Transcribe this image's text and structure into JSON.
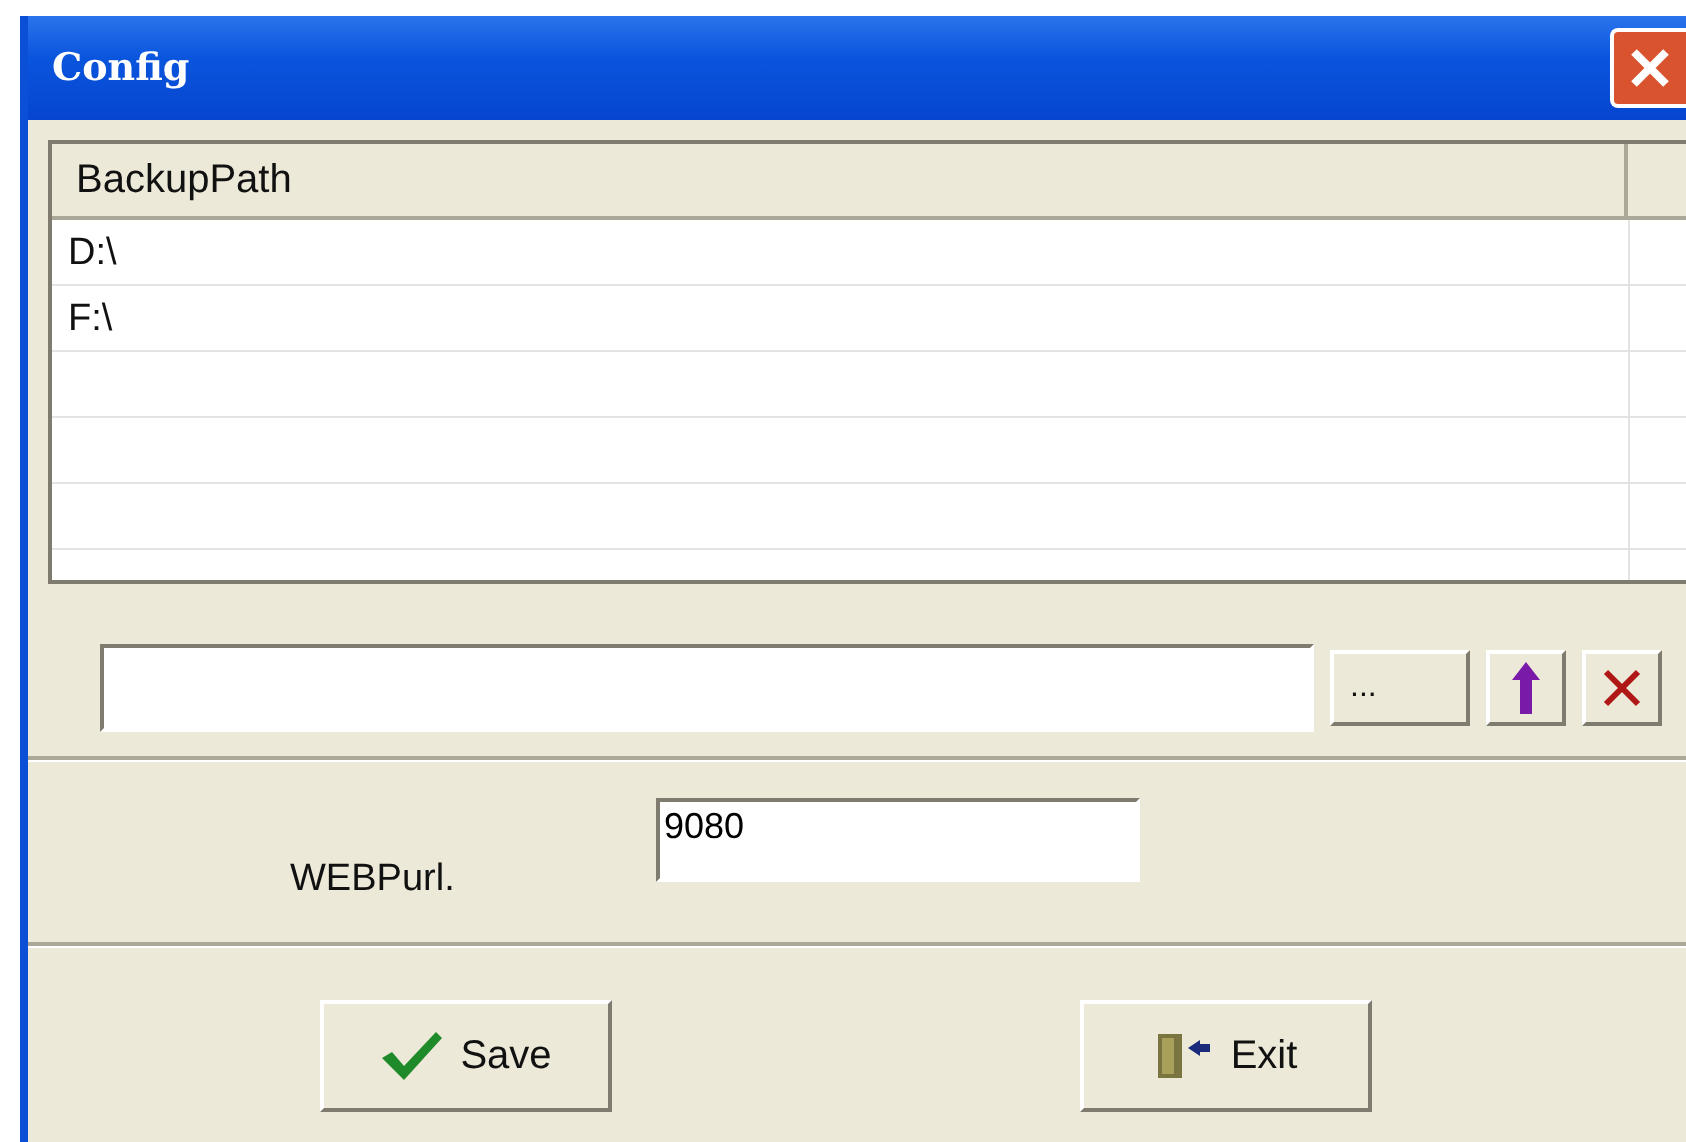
{
  "window": {
    "title": "Config"
  },
  "table": {
    "columns": [
      "BackupPath"
    ],
    "rows": [
      {
        "cells": [
          "D:\\"
        ]
      },
      {
        "cells": [
          "F:\\"
        ]
      }
    ]
  },
  "path_buttons": [
    {
      "kind": "browse",
      "label": "..."
    },
    {
      "kind": "up"
    },
    {
      "kind": "delete"
    }
  ],
  "web_port": {
    "label": "WEBPurl.",
    "value": "9080"
  },
  "buttons": [
    {
      "kind": "save",
      "label": "Save"
    },
    {
      "kind": "exit",
      "label": "Exit"
    }
  ]
}
